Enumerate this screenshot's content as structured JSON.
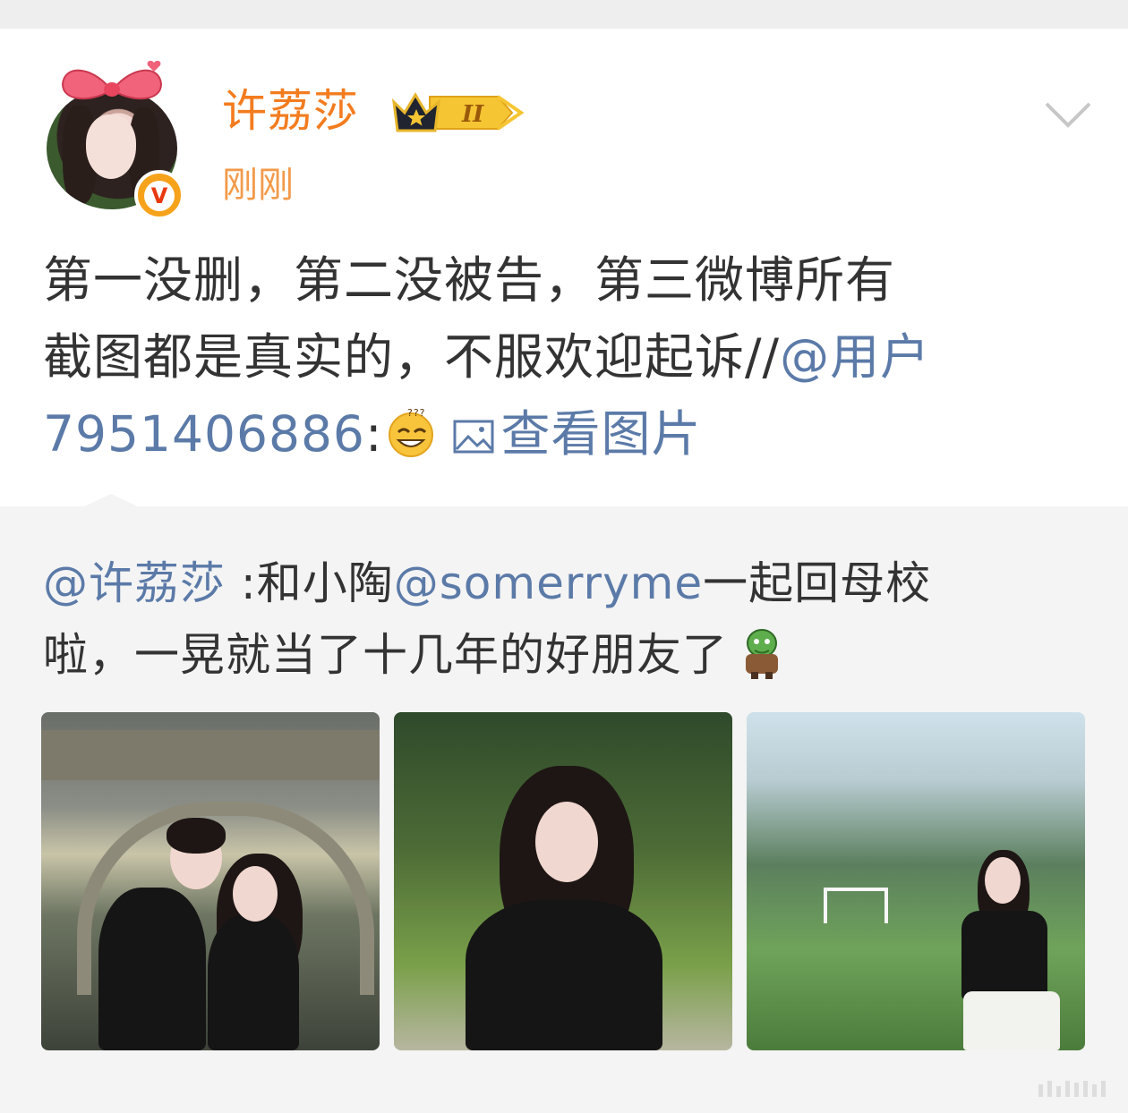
{
  "post": {
    "username": "许荔莎",
    "timestamp": "刚刚",
    "level_badge": "II",
    "verified_mark": "V",
    "text_line1": "第一没删，第二没被告，第三微博所有",
    "text_line2": "截图都是真实的，不服欢迎起诉//",
    "mention": "@用户",
    "mention_id": "7951406886",
    "mention_colon": ":",
    "view_pictures": "查看图片"
  },
  "repost": {
    "mention_author": "@许荔莎",
    "text_part1": " :和小陶",
    "mention_friend": "@somerryme",
    "text_part2": "一起回母校",
    "text_line2": "啦，一晃就当了十几年的好朋友了",
    "images": [
      {
        "name": "photo-school-gate"
      },
      {
        "name": "photo-trees"
      },
      {
        "name": "photo-field"
      }
    ]
  },
  "icons": {
    "more": "chevron-down-icon",
    "crown": "crown-level-icon",
    "verified": "verified-badge-icon",
    "image": "image-icon",
    "emoji1": "dizzy-smile-emoji",
    "emoji2": "monster-emoji"
  },
  "colors": {
    "username": "#f37c1f",
    "link": "#5b7aa8",
    "repost_bg": "#f4f4f4"
  }
}
